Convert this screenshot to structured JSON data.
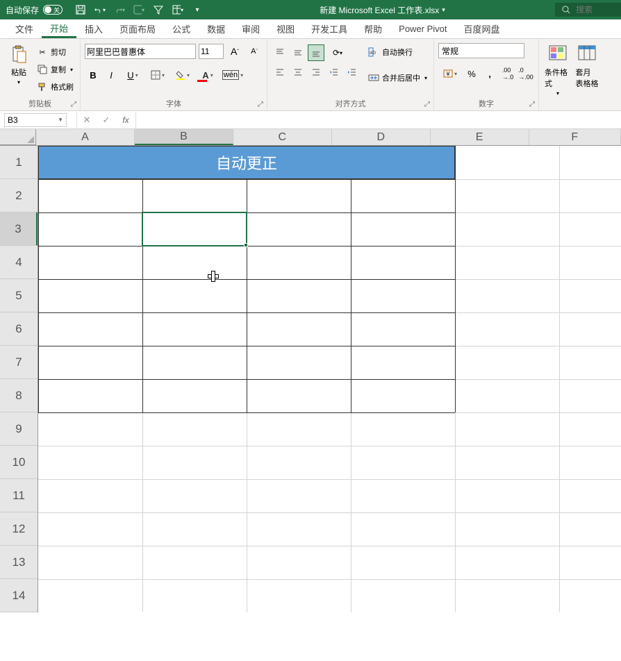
{
  "titlebar": {
    "autosave": "自动保存",
    "autosave_off": "关",
    "filename": "新建 Microsoft Excel 工作表.xlsx",
    "search_placeholder": "搜索"
  },
  "tabs": [
    "文件",
    "开始",
    "插入",
    "页面布局",
    "公式",
    "数据",
    "审阅",
    "视图",
    "开发工具",
    "帮助",
    "Power Pivot",
    "百度网盘"
  ],
  "active_tab": 1,
  "ribbon": {
    "clipboard": {
      "label": "剪贴板",
      "paste": "粘贴",
      "cut": "剪切",
      "copy": "复制",
      "fmt": "格式刷"
    },
    "font": {
      "label": "字体",
      "name": "阿里巴巴普惠体",
      "size": "11"
    },
    "align": {
      "label": "对齐方式",
      "wrap": "自动换行",
      "merge": "合并后居中"
    },
    "number": {
      "label": "数字",
      "format": "常规"
    },
    "styles": {
      "cond": "条件格式",
      "tbl": "套月\n表格格"
    }
  },
  "formulabar": {
    "cell_ref": "B3"
  },
  "grid": {
    "columns": [
      "A",
      "B",
      "C",
      "D",
      "E",
      "F"
    ],
    "rows": [
      "1",
      "2",
      "3",
      "4",
      "5",
      "6",
      "7",
      "8",
      "9",
      "10",
      "11",
      "12",
      "13",
      "14"
    ],
    "active_col": "B",
    "active_row": "3",
    "merged_title": "自动更正"
  }
}
